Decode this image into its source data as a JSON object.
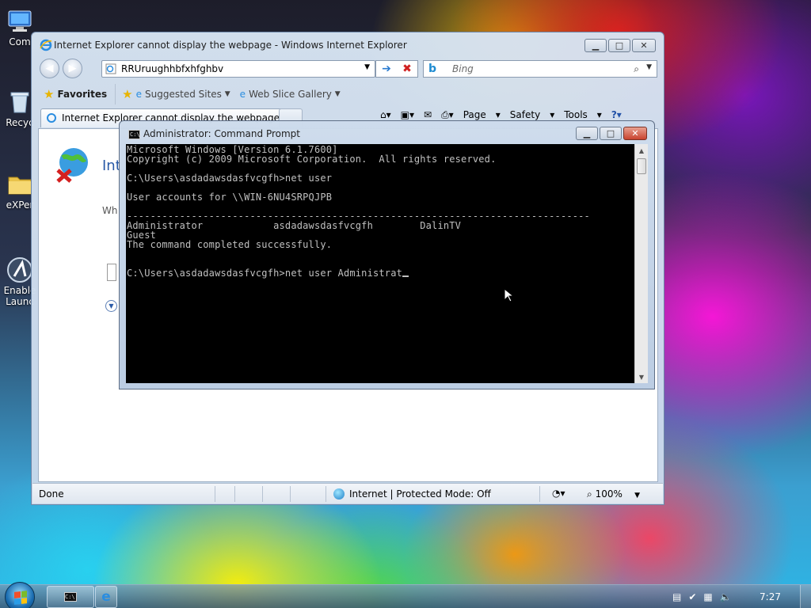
{
  "desktop": {
    "icons": [
      {
        "label": "Com",
        "icon": "computer-icon"
      },
      {
        "label": "Recyc",
        "icon": "recycle-bin-icon"
      },
      {
        "label": "eXPer",
        "icon": "folder-icon"
      },
      {
        "label": "Enable Launc",
        "icon": "launcher-icon"
      }
    ]
  },
  "ie": {
    "title": "Internet Explorer cannot display the webpage - Windows Internet Explorer",
    "address": "RRUruughhbfxhfghbv",
    "search_placeholder": "Bing",
    "favorites_label": "Favorites",
    "suggested_sites": "Suggested Sites",
    "web_slice_gallery": "Web Slice Gallery",
    "tab_title": "Internet Explorer cannot display the webpage",
    "commands": [
      "Page",
      "Safety",
      "Tools"
    ],
    "page_heading": "Int",
    "page_line": "Wh",
    "status": "Done",
    "zone": "Internet | Protected Mode: Off",
    "zoom": "100%"
  },
  "cmd": {
    "title": "Administrator: Command Prompt",
    "lines": [
      "Microsoft Windows [Version 6.1.7600]",
      "Copyright (c) 2009 Microsoft Corporation.  All rights reserved.",
      "",
      "C:\\Users\\asdadawsdasfvcgfh>net user",
      "",
      "User accounts for \\\\WIN-6NU4SRPQJPB",
      "",
      "-------------------------------------------------------------------------------",
      "Administrator            asdadawsdasfvcgfh        DalinTV",
      "Guest",
      "The command completed successfully.",
      "",
      "",
      "C:\\Users\\asdadawsdasfvcgfh>net user Administrat"
    ]
  },
  "taskbar": {
    "clock": "7:27"
  },
  "colors": {
    "console_bg": "#000000",
    "console_text": "#c0c0c0",
    "ie_frame": "#d7e4f2"
  }
}
